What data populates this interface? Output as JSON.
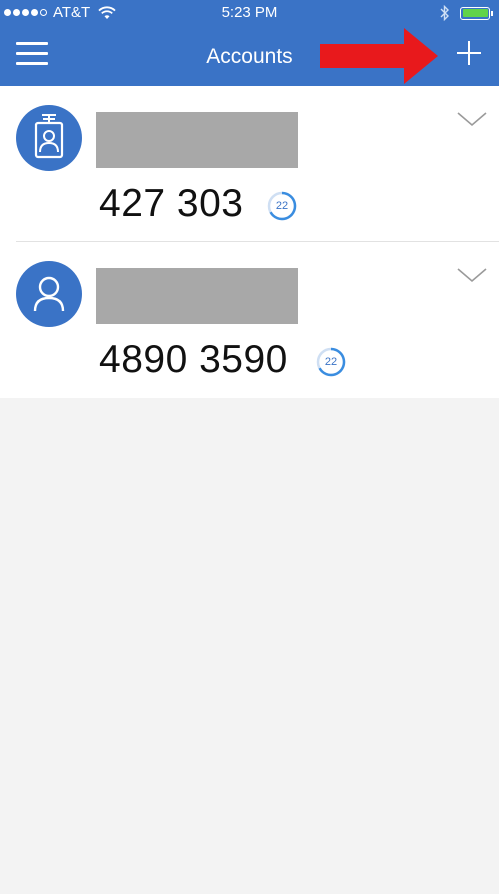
{
  "status_bar": {
    "carrier": "AT&T",
    "time": "5:23 PM",
    "signal_icon": "signal-dots-icon",
    "wifi_icon": "wifi-icon",
    "bluetooth_icon": "bluetooth-icon",
    "battery_icon": "battery-icon",
    "battery_color": "#61d34a"
  },
  "header": {
    "title": "Accounts",
    "menu_icon": "hamburger-menu-icon",
    "add_icon": "plus-icon",
    "background": "#3a73c6"
  },
  "annotation": {
    "arrow_icon": "red-arrow-icon",
    "color": "#e8191c"
  },
  "accounts": [
    {
      "avatar_icon": "id-badge-icon",
      "code": "427 303",
      "timer": "22",
      "expand_icon": "chevron-down-icon"
    },
    {
      "avatar_icon": "user-icon",
      "code": "4890 3590",
      "timer": "22",
      "expand_icon": "chevron-down-icon"
    }
  ]
}
